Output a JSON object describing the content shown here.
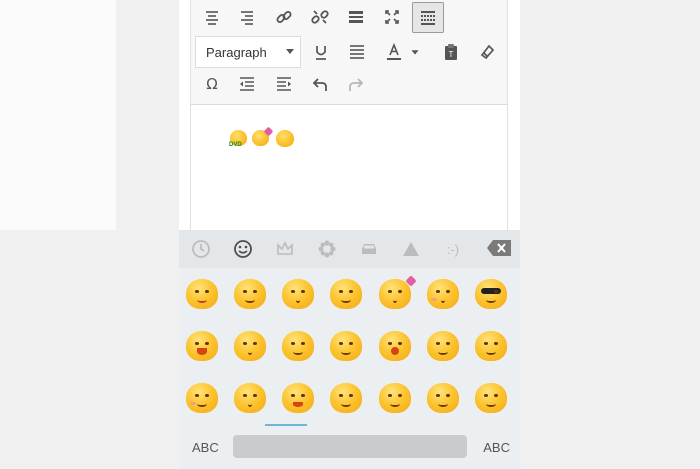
{
  "toolbar": {
    "format_select": "Paragraph",
    "buttons_row1": [
      "align-center-icon",
      "align-right-icon",
      "link-icon",
      "unlink-icon",
      "read-more-icon",
      "fullscreen-icon",
      "toolbar-toggle-icon"
    ],
    "buttons_row2": [
      "underline-icon",
      "justify-icon",
      "text-color-icon",
      "text-color-dropdown-icon",
      "paste-text-icon",
      "clear-formatting-icon"
    ],
    "buttons_row3": [
      "special-character-icon",
      "outdent-icon",
      "indent-icon",
      "undo-icon",
      "redo-icon"
    ]
  },
  "content": {
    "inserted_emojis": [
      "dvd-emoji",
      "heart-emoji",
      "hands-up-emoji"
    ],
    "dvd_label": "DVD"
  },
  "keyboard": {
    "categories": [
      "recent",
      "smileys",
      "objects",
      "nature",
      "places",
      "symbols",
      "emoticons"
    ],
    "active_category": "smileys",
    "emoticon_label": ":-)",
    "left_label": "ABC",
    "right_label": "ABC",
    "emoji_rows": [
      [
        "squinting-tongue",
        "winking",
        "kissing",
        "thinking-smile",
        "kiss-heart",
        "kissing-blush",
        "sunglasses"
      ],
      [
        "crying-laughing",
        "relieved",
        "persevering",
        "pensive",
        "yawning",
        "smirk",
        "drooling"
      ],
      [
        "confounded",
        "hands-up",
        "raising-hands",
        "sleepy",
        "crossed-arms",
        "halo",
        "hiding"
      ]
    ]
  },
  "colors": {
    "emoji_yellow": "#fbc02d",
    "indicator": "#6fb7d1",
    "keyboard_bg": "#eceff1"
  }
}
